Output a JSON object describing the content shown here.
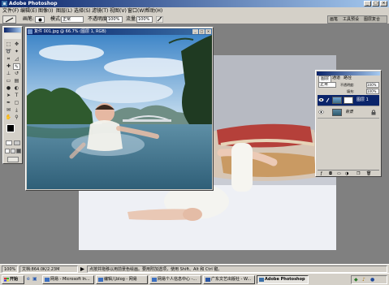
{
  "app": {
    "title": "Adobe Photoshop"
  },
  "menu": [
    "文件(F)",
    "编辑(E)",
    "图像(I)",
    "图层(L)",
    "选择(S)",
    "滤镜(T)",
    "视图(V)",
    "窗口(W)",
    "帮助(H)"
  ],
  "options": {
    "label_mode": "画笔:",
    "label_blend": "模式:",
    "blend_mode": "正常",
    "label_opacity": "不透明度:",
    "opacity": "100%",
    "label_flow": "流量:",
    "flow": "100%",
    "right_tabs": [
      "画笔",
      "工具预设",
      "图层复合"
    ]
  },
  "document": {
    "title": "复件 001.jpg @ 66.7% (图层 1, RGB)"
  },
  "layers_panel": {
    "tabs": [
      "图层",
      "通道",
      "路径"
    ],
    "blend_mode": "正常",
    "opacity_label": "不透明度:",
    "opacity": "100%",
    "fill_label": "填充:",
    "fill": "100%",
    "layers": [
      {
        "name": "图层 1",
        "selected": true
      },
      {
        "name": "背景",
        "selected": false
      }
    ]
  },
  "status": {
    "zoom": "100%",
    "doc_size": "文档:864.0K/2.23M",
    "hint": "点按并拖移以用前景色绘画。要用附加选项，使用 Shift、Alt 和 Ctrl 键。"
  },
  "taskbar": {
    "buttons": [
      {
        "label": "开始",
        "active": false
      },
      {
        "label": "网易 - Microsoft In...",
        "active": false
      },
      {
        "label": "编辑儿blog - 网易",
        "active": false
      },
      {
        "label": "网易个人信息中心 -...",
        "active": false
      },
      {
        "label": "广东文艺出版社 - W...",
        "active": false
      },
      {
        "label": "Adobe Photoshop",
        "active": true
      }
    ]
  },
  "colors": {
    "titlebar": "#0a246a",
    "chrome": "#d4d0c8",
    "workspace": "#808080",
    "selected_layer": "#0a246a"
  }
}
